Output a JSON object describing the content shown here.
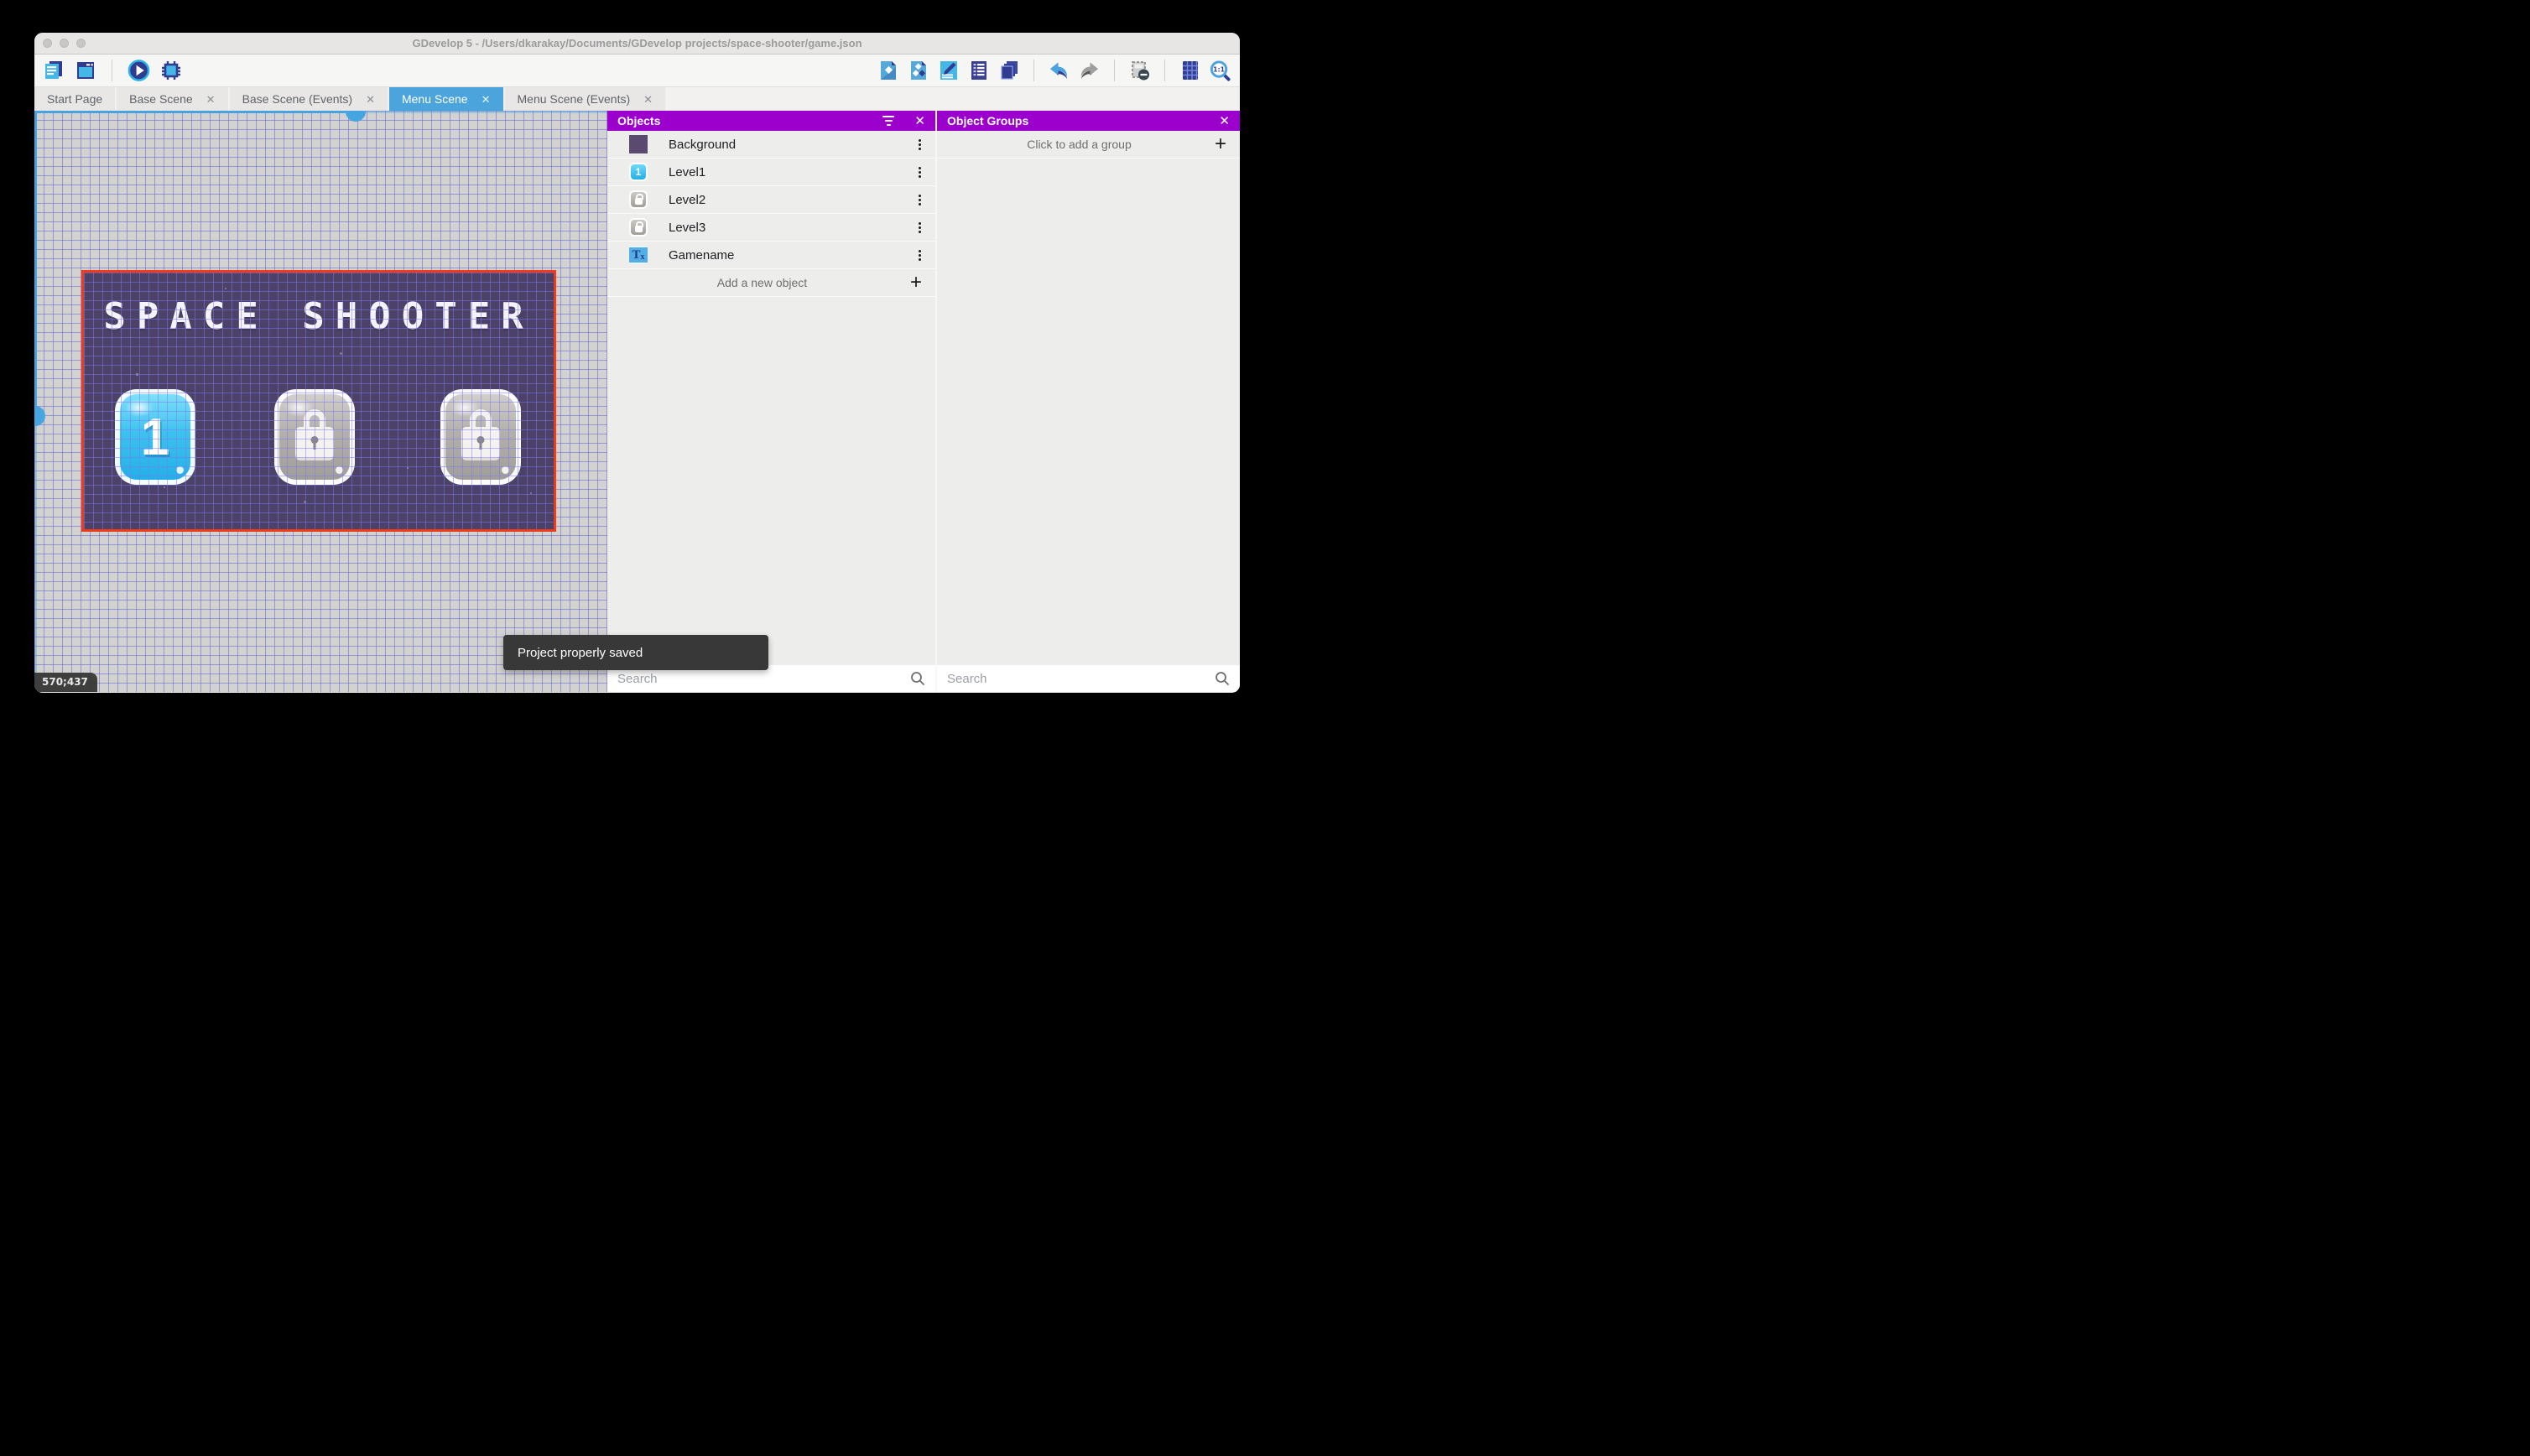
{
  "window": {
    "title": "GDevelop 5 - /Users/dkarakay/Documents/GDevelop projects/space-shooter/game.json"
  },
  "toolbar": {
    "left_icons": [
      "project-manager-icon",
      "start-page-icon",
      "play-icon",
      "debug-icon"
    ],
    "right_icons": [
      "objects-panel-icon",
      "object-groups-panel-icon",
      "properties-panel-icon",
      "instances-list-icon",
      "layers-panel-icon",
      "undo-icon",
      "redo-icon",
      "toggle-instances-mask-icon",
      "grid-icon",
      "zoom-original-icon"
    ]
  },
  "tabs": [
    {
      "label": "Start Page",
      "closable": false,
      "active": false
    },
    {
      "label": "Base Scene",
      "closable": true,
      "active": false
    },
    {
      "label": "Base Scene (Events)",
      "closable": true,
      "active": false
    },
    {
      "label": "Menu Scene",
      "closable": true,
      "active": true
    },
    {
      "label": "Menu Scene (Events)",
      "closable": true,
      "active": false
    }
  ],
  "canvas": {
    "coordinates": "570;437",
    "scene": {
      "title": "SPACE SHOOTER",
      "buttons": [
        {
          "label": "1",
          "state": "unlocked"
        },
        {
          "label": "",
          "state": "locked"
        },
        {
          "label": "",
          "state": "locked"
        }
      ]
    }
  },
  "objects_panel": {
    "title": "Objects",
    "rows": [
      {
        "name": "Background",
        "icon": "background-thumbnail"
      },
      {
        "name": "Level1",
        "icon": "level1-button-thumbnail"
      },
      {
        "name": "Level2",
        "icon": "locked-button-thumbnail"
      },
      {
        "name": "Level3",
        "icon": "locked-button-thumbnail"
      },
      {
        "name": "Gamename",
        "icon": "text-object-thumbnail"
      }
    ],
    "add_label": "Add a new object",
    "search_placeholder": "Search"
  },
  "groups_panel": {
    "title": "Object Groups",
    "add_label": "Click to add a group",
    "search_placeholder": "Search"
  },
  "toast": {
    "message": "Project properly saved"
  },
  "icons": {
    "close_glyph": "✕",
    "plus_glyph": "+"
  },
  "colors": {
    "accent_purple": "#9b00cd",
    "active_tab_blue": "#4ba4dc",
    "scene_background": "#4c4167",
    "scene_border_red": "#f23a18",
    "level_button_blue": "#23b0e7",
    "locked_button_gray": "#a19e9a",
    "grid_line_blue": "#6464d2",
    "toast_background": "#383838"
  }
}
